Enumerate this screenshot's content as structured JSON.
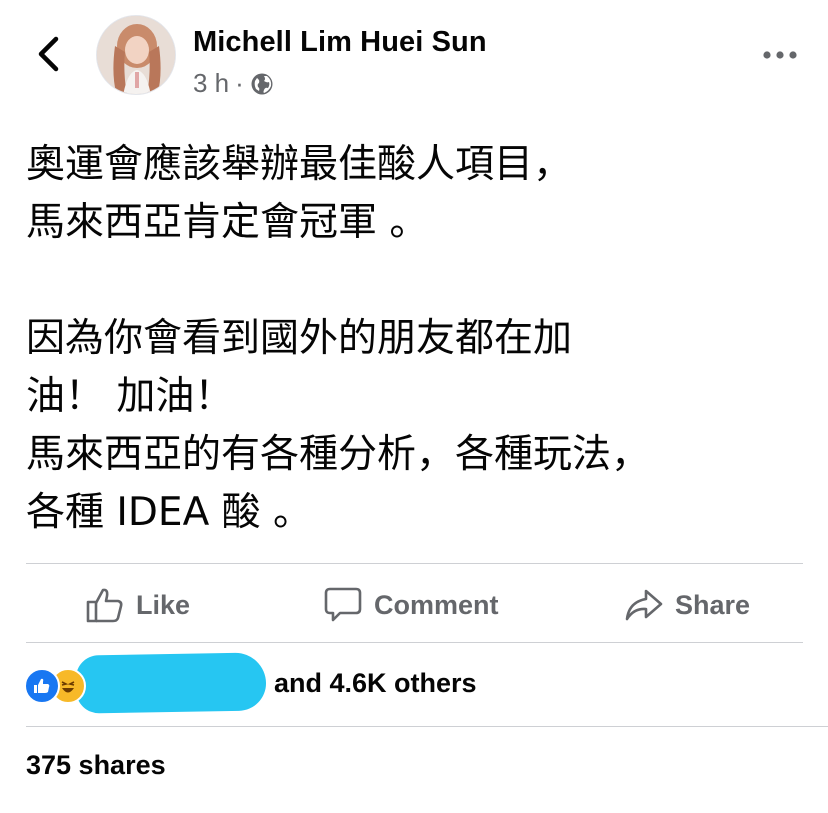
{
  "post": {
    "author": "Michell Lim Huei Sun",
    "time": "3 h",
    "separator": "·",
    "audience_icon": "globe-icon",
    "text": "奧運會應該舉辦最佳酸人項目，\n馬來西亞肯定會冠軍 。\n\n因為你會看到國外的朋友都在加\n油！ 加油！\n馬來西亞的有各種分析，各種玩法，\n各種 IDEA 酸 。"
  },
  "actions": {
    "like": "Like",
    "comment": "Comment",
    "share": "Share"
  },
  "reactions": {
    "icons": [
      "like-reaction-icon",
      "haha-reaction-icon"
    ],
    "summary": "and 4.6K others"
  },
  "shares": "375 shares",
  "colors": {
    "text": "#050505",
    "secondary": "#65676b",
    "like_blue": "#1877f2",
    "haha_yellow": "#f7b928",
    "redaction": "#26c6f2",
    "divider": "#ced0d4"
  }
}
